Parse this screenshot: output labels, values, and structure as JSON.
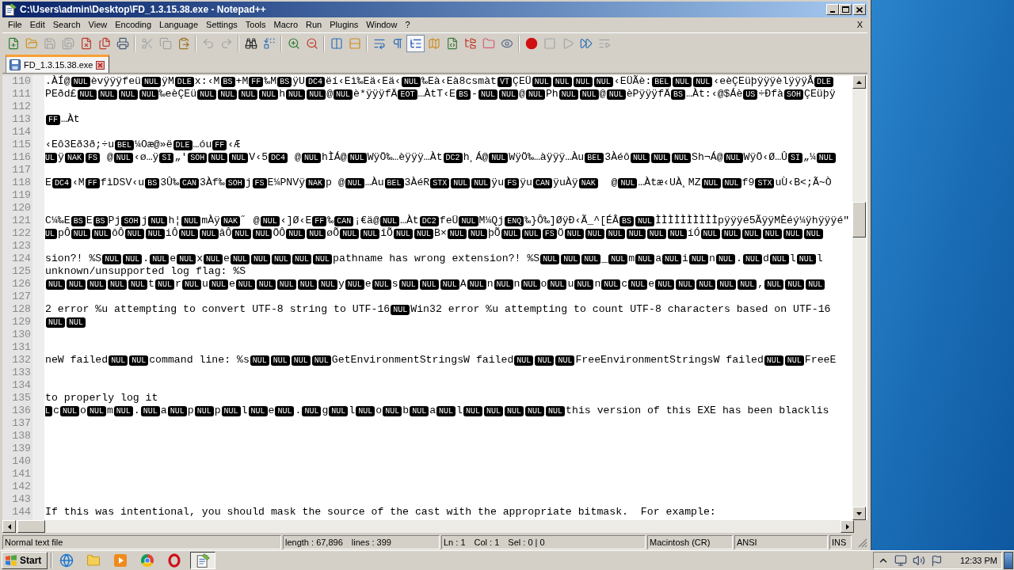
{
  "window": {
    "title": "C:\\Users\\admin\\Desktop\\FD_1.3.15.38.exe - Notepad++"
  },
  "menu": {
    "items": [
      "File",
      "Edit",
      "Search",
      "View",
      "Encoding",
      "Language",
      "Settings",
      "Tools",
      "Macro",
      "Run",
      "Plugins",
      "Window",
      "?"
    ],
    "close_document": "X"
  },
  "toolbar": [
    [
      {
        "kind": "new",
        "pressed": false,
        "disabled": false
      },
      {
        "kind": "open",
        "pressed": false,
        "disabled": false
      },
      {
        "kind": "save",
        "pressed": false,
        "disabled": true
      },
      {
        "kind": "save_all",
        "pressed": false,
        "disabled": true
      },
      {
        "kind": "close",
        "pressed": false,
        "disabled": false
      },
      {
        "kind": "close_all",
        "pressed": false,
        "disabled": false
      },
      {
        "kind": "print",
        "pressed": false,
        "disabled": false
      }
    ],
    [
      {
        "kind": "cut",
        "pressed": false,
        "disabled": true
      },
      {
        "kind": "copy",
        "pressed": false,
        "disabled": true
      },
      {
        "kind": "paste",
        "pressed": false,
        "disabled": false
      }
    ],
    [
      {
        "kind": "undo",
        "pressed": false,
        "disabled": true
      },
      {
        "kind": "redo",
        "pressed": false,
        "disabled": true
      }
    ],
    [
      {
        "kind": "find",
        "pressed": false,
        "disabled": false
      },
      {
        "kind": "replace",
        "pressed": false,
        "disabled": false
      }
    ],
    [
      {
        "kind": "zoom_in",
        "pressed": false,
        "disabled": false
      },
      {
        "kind": "zoom_out",
        "pressed": false,
        "disabled": false
      }
    ],
    [
      {
        "kind": "sync_vertical",
        "pressed": false,
        "disabled": false
      },
      {
        "kind": "sync_horizontal",
        "pressed": false,
        "disabled": false
      }
    ],
    [
      {
        "kind": "word_wrap",
        "pressed": false,
        "disabled": false
      },
      {
        "kind": "all_characters",
        "pressed": false,
        "disabled": false
      },
      {
        "kind": "indent_guide",
        "pressed": true,
        "disabled": false
      },
      {
        "kind": "document_map",
        "pressed": false,
        "disabled": false
      },
      {
        "kind": "function_list",
        "pressed": false,
        "disabled": false
      },
      {
        "kind": "folder_workspace",
        "pressed": false,
        "disabled": false
      },
      {
        "kind": "document_list",
        "pressed": false,
        "disabled": false
      },
      {
        "kind": "monitoring",
        "pressed": false,
        "disabled": false
      }
    ],
    [
      {
        "kind": "record",
        "pressed": false,
        "disabled": false
      },
      {
        "kind": "stop",
        "pressed": false,
        "disabled": true
      },
      {
        "kind": "playback",
        "pressed": false,
        "disabled": true
      },
      {
        "kind": "run_multiple",
        "pressed": false,
        "disabled": false
      },
      {
        "kind": "save_macro",
        "pressed": false,
        "disabled": true
      }
    ]
  ],
  "tabs": [
    {
      "label": "FD_1.3.15.38.exe",
      "selected": true
    }
  ],
  "editor": {
    "lines": [
      {
        "number": "110",
        "segments": [
          {
            "kind": "text",
            "text": ".ÀÍ@"
          },
          {
            "kind": "control",
            "text": "NUL"
          },
          {
            "kind": "text",
            "text": "èvÿÿÿfeü"
          },
          {
            "kind": "control",
            "text": "NUL"
          },
          {
            "kind": "text",
            "text": "ÿM"
          },
          {
            "kind": "control",
            "text": "DLE"
          },
          {
            "kind": "text",
            "text": "x:‹M"
          },
          {
            "kind": "control",
            "text": "BS"
          },
          {
            "kind": "text",
            "text": "+M"
          },
          {
            "kind": "control",
            "text": "FF"
          },
          {
            "kind": "text",
            "text": "‰M"
          },
          {
            "kind": "control",
            "text": "BS"
          },
          {
            "kind": "text",
            "text": "ÿU"
          },
          {
            "kind": "control",
            "text": "DC4"
          },
          {
            "kind": "text",
            "text": "ëí‹Eì‰Eä‹Eä‹"
          },
          {
            "kind": "control",
            "text": "NUL"
          },
          {
            "kind": "text",
            "text": "‰Eà‹Eà8csmàt"
          },
          {
            "kind": "control",
            "text": "VT"
          },
          {
            "kind": "text",
            "text": "ÇEÜ"
          },
          {
            "kind": "control",
            "text": "NUL"
          },
          {
            "kind": "control",
            "text": "NUL"
          },
          {
            "kind": "control",
            "text": "NUL"
          },
          {
            "kind": "control",
            "text": "NUL"
          },
          {
            "kind": "text",
            "text": "‹EÜÃè:"
          },
          {
            "kind": "control",
            "text": "BEL"
          },
          {
            "kind": "control",
            "text": "NUL"
          },
          {
            "kind": "control",
            "text": "NUL"
          },
          {
            "kind": "text",
            "text": "‹eèÇEüþÿÿÿèlÿÿÿÂ"
          },
          {
            "kind": "control",
            "text": "DLE"
          }
        ]
      },
      {
        "number": "111",
        "segments": [
          {
            "kind": "text",
            "text": "PEðd£"
          },
          {
            "kind": "control",
            "text": "NUL"
          },
          {
            "kind": "control",
            "text": "NUL"
          },
          {
            "kind": "control",
            "text": "NUL"
          },
          {
            "kind": "control",
            "text": "NUL"
          },
          {
            "kind": "text",
            "text": "‰eèÇEü"
          },
          {
            "kind": "control",
            "text": "NUL"
          },
          {
            "kind": "control",
            "text": "NUL"
          },
          {
            "kind": "control",
            "text": "NUL"
          },
          {
            "kind": "control",
            "text": "NUL"
          },
          {
            "kind": "text",
            "text": "h"
          },
          {
            "kind": "control",
            "text": "NUL"
          },
          {
            "kind": "control",
            "text": "NUL"
          },
          {
            "kind": "text",
            "text": "@"
          },
          {
            "kind": "control",
            "text": "NUL"
          },
          {
            "kind": "text",
            "text": "è*ÿÿÿfÄ"
          },
          {
            "kind": "control",
            "text": "EOT"
          },
          {
            "kind": "text",
            "text": "…ÀtT‹E"
          },
          {
            "kind": "control",
            "text": "BS"
          },
          {
            "kind": "text",
            "text": "-"
          },
          {
            "kind": "control",
            "text": "NUL"
          },
          {
            "kind": "control",
            "text": "NUL"
          },
          {
            "kind": "text",
            "text": "@"
          },
          {
            "kind": "control",
            "text": "NUL"
          },
          {
            "kind": "text",
            "text": "Ph"
          },
          {
            "kind": "control",
            "text": "NUL"
          },
          {
            "kind": "control",
            "text": "NUL"
          },
          {
            "kind": "text",
            "text": "@"
          },
          {
            "kind": "control",
            "text": "NUL"
          },
          {
            "kind": "text",
            "text": "èPÿÿÿfÄ"
          },
          {
            "kind": "control",
            "text": "BS"
          },
          {
            "kind": "text",
            "text": "…Àt:‹@$Áè"
          },
          {
            "kind": "control",
            "text": "US"
          },
          {
            "kind": "text",
            "text": "÷Ðfà"
          },
          {
            "kind": "control",
            "text": "SOH"
          },
          {
            "kind": "text",
            "text": "ÇEüþÿ"
          }
        ]
      },
      {
        "number": "112"
      },
      {
        "number": "113",
        "segments": [
          {
            "kind": "control",
            "text": "FF"
          },
          {
            "kind": "text",
            "text": "…Àt"
          }
        ]
      },
      {
        "number": "114"
      },
      {
        "number": "115",
        "segments": [
          {
            "kind": "text",
            "text": "‹Eô3Eð3ð;÷u"
          },
          {
            "kind": "control",
            "text": "BEL"
          },
          {
            "kind": "text",
            "text": "¼Oæ@»ë"
          },
          {
            "kind": "control",
            "text": "DLE"
          },
          {
            "kind": "text",
            "text": "…óu"
          },
          {
            "kind": "control",
            "text": "FF"
          },
          {
            "kind": "text",
            "text": "‹Æ"
          }
        ]
      },
      {
        "number": "116",
        "segments": [
          {
            "kind": "control_clipped",
            "text": "UL"
          },
          {
            "kind": "text",
            "text": "ÿ"
          },
          {
            "kind": "control",
            "text": "NAK"
          },
          {
            "kind": "control",
            "text": "FS"
          },
          {
            "kind": "text",
            "text": " @"
          },
          {
            "kind": "control",
            "text": "NUL"
          },
          {
            "kind": "text",
            "text": "‹ø…ÿ"
          },
          {
            "kind": "control",
            "text": "SI"
          },
          {
            "kind": "text",
            "text": "„'"
          },
          {
            "kind": "control",
            "text": "SOH"
          },
          {
            "kind": "control",
            "text": "NUL"
          },
          {
            "kind": "control",
            "text": "NUL"
          },
          {
            "kind": "text",
            "text": "V‹5"
          },
          {
            "kind": "control",
            "text": "DC4"
          },
          {
            "kind": "text",
            "text": " @"
          },
          {
            "kind": "control",
            "text": "NUL"
          },
          {
            "kind": "text",
            "text": "hÌÁ@"
          },
          {
            "kind": "control",
            "text": "NUL"
          },
          {
            "kind": "text",
            "text": "WÿÖ‰…èÿÿÿ…Àt"
          },
          {
            "kind": "control",
            "text": "DC2"
          },
          {
            "kind": "text",
            "text": "h¸Á@"
          },
          {
            "kind": "control",
            "text": "NUL"
          },
          {
            "kind": "text",
            "text": "WÿÖ‰…àÿÿÿ…Àu"
          },
          {
            "kind": "control",
            "text": "BEL"
          },
          {
            "kind": "text",
            "text": "3Àéô"
          },
          {
            "kind": "control",
            "text": "NUL"
          },
          {
            "kind": "control",
            "text": "NUL"
          },
          {
            "kind": "control",
            "text": "NUL"
          },
          {
            "kind": "text",
            "text": "Sh¬Á@"
          },
          {
            "kind": "control",
            "text": "NUL"
          },
          {
            "kind": "text",
            "text": "WÿÖ‹Ø…Û"
          },
          {
            "kind": "control",
            "text": "SI"
          },
          {
            "kind": "text",
            "text": "„¼"
          },
          {
            "kind": "control",
            "text": "NUL"
          }
        ]
      },
      {
        "number": "117"
      },
      {
        "number": "118",
        "segments": [
          {
            "kind": "text",
            "text": "E"
          },
          {
            "kind": "control",
            "text": "DC4"
          },
          {
            "kind": "text",
            "text": "‹M"
          },
          {
            "kind": "control",
            "text": "FF"
          },
          {
            "kind": "text",
            "text": "fìDSV‹u"
          },
          {
            "kind": "control",
            "text": "BS"
          },
          {
            "kind": "text",
            "text": "3Û‰"
          },
          {
            "kind": "control",
            "text": "CAN"
          },
          {
            "kind": "text",
            "text": "3Àf‰"
          },
          {
            "kind": "control",
            "text": "SOH"
          },
          {
            "kind": "text",
            "text": "j"
          },
          {
            "kind": "control",
            "text": "FS"
          },
          {
            "kind": "text",
            "text": "E¼PNVÿ"
          },
          {
            "kind": "control",
            "text": "NAK"
          },
          {
            "kind": "text",
            "text": "p @"
          },
          {
            "kind": "control",
            "text": "NUL"
          },
          {
            "kind": "text",
            "text": "…Àu"
          },
          {
            "kind": "control",
            "text": "BEL"
          },
          {
            "kind": "text",
            "text": "3ÀéR"
          },
          {
            "kind": "control",
            "text": "STX"
          },
          {
            "kind": "control",
            "text": "NUL"
          },
          {
            "kind": "control",
            "text": "NUL"
          },
          {
            "kind": "text",
            "text": "ÿu"
          },
          {
            "kind": "control",
            "text": "FS"
          },
          {
            "kind": "text",
            "text": "ÿu"
          },
          {
            "kind": "control",
            "text": "CAN"
          },
          {
            "kind": "text",
            "text": "ÿuÀÿ"
          },
          {
            "kind": "control",
            "text": "NAK"
          },
          {
            "kind": "text",
            "text": "  @"
          },
          {
            "kind": "control",
            "text": "NUL"
          },
          {
            "kind": "text",
            "text": "…Àtæ‹UÀ¸MZ"
          },
          {
            "kind": "control",
            "text": "NUL"
          },
          {
            "kind": "control",
            "text": "NUL"
          },
          {
            "kind": "text",
            "text": "f9"
          },
          {
            "kind": "control",
            "text": "STX"
          },
          {
            "kind": "text",
            "text": "uÙ‹B<;Ã~Ò"
          }
        ]
      },
      {
        "number": "119"
      },
      {
        "number": "120"
      },
      {
        "number": "121",
        "segments": [
          {
            "kind": "text",
            "text": "C¼‰E"
          },
          {
            "kind": "control",
            "text": "BS"
          },
          {
            "kind": "text",
            "text": "E"
          },
          {
            "kind": "control",
            "text": "BS"
          },
          {
            "kind": "text",
            "text": "Pj"
          },
          {
            "kind": "control",
            "text": "SOH"
          },
          {
            "kind": "text",
            "text": "j"
          },
          {
            "kind": "control",
            "text": "NUL"
          },
          {
            "kind": "text",
            "text": "h¦"
          },
          {
            "kind": "control",
            "text": "NUL"
          },
          {
            "kind": "text",
            "text": "mÀÿ"
          },
          {
            "kind": "control",
            "text": "NAK"
          },
          {
            "kind": "text",
            "text": "˝ @"
          },
          {
            "kind": "control",
            "text": "NUL"
          },
          {
            "kind": "text",
            "text": "‹]Ø‹E"
          },
          {
            "kind": "control",
            "text": "FF"
          },
          {
            "kind": "text",
            "text": "‰"
          },
          {
            "kind": "control",
            "text": "CAN"
          },
          {
            "kind": "text",
            "text": "¡€ä@"
          },
          {
            "kind": "control",
            "text": "NUL"
          },
          {
            "kind": "text",
            "text": "…Àt"
          },
          {
            "kind": "control",
            "text": "DC2"
          },
          {
            "kind": "text",
            "text": "feÜ"
          },
          {
            "kind": "control",
            "text": "NUL"
          },
          {
            "kind": "text",
            "text": "M¼Qj"
          },
          {
            "kind": "control",
            "text": "ENQ"
          },
          {
            "kind": "text",
            "text": "‰}Ô‰]ØÿÐ‹Ã_^[ÉÂ"
          },
          {
            "kind": "control",
            "text": "BS"
          },
          {
            "kind": "control",
            "text": "NUL"
          },
          {
            "kind": "text",
            "text": "ÌÌÌÌÌÌÌÌÌÌpÿÿÿé5ÃÿÿMÈéý¼ÿhÿÿÿé\""
          }
        ]
      },
      {
        "number": "122",
        "segments": [
          {
            "kind": "control_clipped",
            "text": "UL"
          },
          {
            "kind": "text",
            "text": "pÔ"
          },
          {
            "kind": "control",
            "text": "NUL"
          },
          {
            "kind": "control",
            "text": "NUL"
          },
          {
            "kind": "text",
            "text": "ôÔ"
          },
          {
            "kind": "control",
            "text": "NUL"
          },
          {
            "kind": "control",
            "text": "NUL"
          },
          {
            "kind": "text",
            "text": "iÔ"
          },
          {
            "kind": "control",
            "text": "NUL"
          },
          {
            "kind": "control",
            "text": "NUL"
          },
          {
            "kind": "text",
            "text": "âÔ"
          },
          {
            "kind": "control",
            "text": "NUL"
          },
          {
            "kind": "control",
            "text": "NUL"
          },
          {
            "kind": "text",
            "text": "ÖÔ"
          },
          {
            "kind": "control",
            "text": "NUL"
          },
          {
            "kind": "control",
            "text": "NUL"
          },
          {
            "kind": "text",
            "text": "øÕ"
          },
          {
            "kind": "control",
            "text": "NUL"
          },
          {
            "kind": "control",
            "text": "NUL"
          },
          {
            "kind": "text",
            "text": "îÕ"
          },
          {
            "kind": "control",
            "text": "NUL"
          },
          {
            "kind": "control",
            "text": "NUL"
          },
          {
            "kind": "text",
            "text": "B×"
          },
          {
            "kind": "control",
            "text": "NUL"
          },
          {
            "kind": "control",
            "text": "NUL"
          },
          {
            "kind": "text",
            "text": "þÕ"
          },
          {
            "kind": "control",
            "text": "NUL"
          },
          {
            "kind": "control",
            "text": "NUL"
          },
          {
            "kind": "control",
            "text": "FS"
          },
          {
            "kind": "text",
            "text": "Ö"
          },
          {
            "kind": "control",
            "text": "NUL"
          },
          {
            "kind": "control",
            "text": "NUL"
          },
          {
            "kind": "control",
            "text": "NUL"
          },
          {
            "kind": "control",
            "text": "NUL"
          },
          {
            "kind": "control",
            "text": "NUL"
          },
          {
            "kind": "control",
            "text": "NUL"
          },
          {
            "kind": "text",
            "text": "íÓ"
          },
          {
            "kind": "control",
            "text": "NUL"
          },
          {
            "kind": "control",
            "text": "NUL"
          },
          {
            "kind": "control",
            "text": "NUL"
          },
          {
            "kind": "control",
            "text": "NUL"
          },
          {
            "kind": "control",
            "text": "NUL"
          },
          {
            "kind": "control",
            "text": "NUL"
          }
        ]
      },
      {
        "number": "123"
      },
      {
        "number": "124",
        "segments": [
          {
            "kind": "text",
            "text": "sion?! %S"
          },
          {
            "kind": "control",
            "text": "NUL"
          },
          {
            "kind": "control",
            "text": "NUL"
          },
          {
            "kind": "text",
            "text": "."
          },
          {
            "kind": "control",
            "text": "NUL"
          },
          {
            "kind": "text",
            "text": "e"
          },
          {
            "kind": "control",
            "text": "NUL"
          },
          {
            "kind": "text",
            "text": "x"
          },
          {
            "kind": "control",
            "text": "NUL"
          },
          {
            "kind": "text",
            "text": "e"
          },
          {
            "kind": "control",
            "text": "NUL"
          },
          {
            "kind": "control",
            "text": "NUL"
          },
          {
            "kind": "control",
            "text": "NUL"
          },
          {
            "kind": "control",
            "text": "NUL"
          },
          {
            "kind": "control",
            "text": "NUL"
          },
          {
            "kind": "text",
            "text": "pathname has wrong extension?! %S"
          },
          {
            "kind": "control",
            "text": "NUL"
          },
          {
            "kind": "control",
            "text": "NUL"
          },
          {
            "kind": "control",
            "text": "NUL"
          },
          {
            "kind": "text",
            "text": "_"
          },
          {
            "kind": "control",
            "text": "NUL"
          },
          {
            "kind": "text",
            "text": "m"
          },
          {
            "kind": "control",
            "text": "NUL"
          },
          {
            "kind": "text",
            "text": "a"
          },
          {
            "kind": "control",
            "text": "NUL"
          },
          {
            "kind": "text",
            "text": "i"
          },
          {
            "kind": "control",
            "text": "NUL"
          },
          {
            "kind": "text",
            "text": "n"
          },
          {
            "kind": "control",
            "text": "NUL"
          },
          {
            "kind": "text",
            "text": "."
          },
          {
            "kind": "control",
            "text": "NUL"
          },
          {
            "kind": "text",
            "text": "d"
          },
          {
            "kind": "control",
            "text": "NUL"
          },
          {
            "kind": "text",
            "text": "l"
          },
          {
            "kind": "control",
            "text": "NUL"
          },
          {
            "kind": "text",
            "text": "l"
          }
        ]
      },
      {
        "number": "125",
        "segments": [
          {
            "kind": "text",
            "text": "unknown/unsupported log flag: %S"
          }
        ]
      },
      {
        "number": "126",
        "segments": [
          {
            "kind": "control",
            "text": "NUL"
          },
          {
            "kind": "control",
            "text": "NUL"
          },
          {
            "kind": "control",
            "text": "NUL"
          },
          {
            "kind": "control",
            "text": "NUL"
          },
          {
            "kind": "control",
            "text": "NUL"
          },
          {
            "kind": "text",
            "text": "t"
          },
          {
            "kind": "control",
            "text": "NUL"
          },
          {
            "kind": "text",
            "text": "r"
          },
          {
            "kind": "control",
            "text": "NUL"
          },
          {
            "kind": "text",
            "text": "u"
          },
          {
            "kind": "control",
            "text": "NUL"
          },
          {
            "kind": "text",
            "text": "e"
          },
          {
            "kind": "control",
            "text": "NUL"
          },
          {
            "kind": "control",
            "text": "NUL"
          },
          {
            "kind": "control",
            "text": "NUL"
          },
          {
            "kind": "control",
            "text": "NUL"
          },
          {
            "kind": "control",
            "text": "NUL"
          },
          {
            "kind": "text",
            "text": "y"
          },
          {
            "kind": "control",
            "text": "NUL"
          },
          {
            "kind": "text",
            "text": "e"
          },
          {
            "kind": "control",
            "text": "NUL"
          },
          {
            "kind": "text",
            "text": "s"
          },
          {
            "kind": "control",
            "text": "NUL"
          },
          {
            "kind": "control",
            "text": "NUL"
          },
          {
            "kind": "control",
            "text": "NUL"
          },
          {
            "kind": "text",
            "text": "A"
          },
          {
            "kind": "control",
            "text": "NUL"
          },
          {
            "kind": "text",
            "text": "n"
          },
          {
            "kind": "control",
            "text": "NUL"
          },
          {
            "kind": "text",
            "text": "n"
          },
          {
            "kind": "control",
            "text": "NUL"
          },
          {
            "kind": "text",
            "text": "o"
          },
          {
            "kind": "control",
            "text": "NUL"
          },
          {
            "kind": "text",
            "text": "u"
          },
          {
            "kind": "control",
            "text": "NUL"
          },
          {
            "kind": "text",
            "text": "n"
          },
          {
            "kind": "control",
            "text": "NUL"
          },
          {
            "kind": "text",
            "text": "c"
          },
          {
            "kind": "control",
            "text": "NUL"
          },
          {
            "kind": "text",
            "text": "e"
          },
          {
            "kind": "control",
            "text": "NUL"
          },
          {
            "kind": "control",
            "text": "NUL"
          },
          {
            "kind": "control",
            "text": "NUL"
          },
          {
            "kind": "control",
            "text": "NUL"
          },
          {
            "kind": "control",
            "text": "NUL"
          },
          {
            "kind": "text",
            "text": ","
          },
          {
            "kind": "control",
            "text": "NUL"
          },
          {
            "kind": "control",
            "text": "NUL"
          },
          {
            "kind": "control",
            "text": "NUL"
          }
        ]
      },
      {
        "number": "127"
      },
      {
        "number": "128",
        "segments": [
          {
            "kind": "text",
            "text": "2 error %u attempting to convert UTF-8 string to UTF-16"
          },
          {
            "kind": "control",
            "text": "NUL"
          },
          {
            "kind": "text",
            "text": "Win32 error %u attempting to count UTF-8 characters based on UTF-16"
          }
        ]
      },
      {
        "number": "129",
        "segments": [
          {
            "kind": "control",
            "text": "NUL"
          },
          {
            "kind": "control",
            "text": "NUL"
          }
        ]
      },
      {
        "number": "130"
      },
      {
        "number": "131"
      },
      {
        "number": "132",
        "segments": [
          {
            "kind": "text",
            "text": "neW failed"
          },
          {
            "kind": "control",
            "text": "NUL"
          },
          {
            "kind": "control",
            "text": "NUL"
          },
          {
            "kind": "text",
            "text": "command line: %s"
          },
          {
            "kind": "control",
            "text": "NUL"
          },
          {
            "kind": "control",
            "text": "NUL"
          },
          {
            "kind": "control",
            "text": "NUL"
          },
          {
            "kind": "control",
            "text": "NUL"
          },
          {
            "kind": "text",
            "text": "GetEnvironmentStringsW failed"
          },
          {
            "kind": "control",
            "text": "NUL"
          },
          {
            "kind": "control",
            "text": "NUL"
          },
          {
            "kind": "control",
            "text": "NUL"
          },
          {
            "kind": "text",
            "text": "FreeEnvironmentStringsW failed"
          },
          {
            "kind": "control",
            "text": "NUL"
          },
          {
            "kind": "control",
            "text": "NUL"
          },
          {
            "kind": "text",
            "text": "FreeE"
          }
        ]
      },
      {
        "number": "133"
      },
      {
        "number": "134"
      },
      {
        "number": "135",
        "segments": [
          {
            "kind": "text",
            "text": "to properly log it"
          }
        ]
      },
      {
        "number": "136",
        "segments": [
          {
            "kind": "control_clipped",
            "text": "L"
          },
          {
            "kind": "text",
            "text": "c"
          },
          {
            "kind": "control",
            "text": "NUL"
          },
          {
            "kind": "text",
            "text": "o"
          },
          {
            "kind": "control",
            "text": "NUL"
          },
          {
            "kind": "text",
            "text": "m"
          },
          {
            "kind": "control",
            "text": "NUL"
          },
          {
            "kind": "text",
            "text": "."
          },
          {
            "kind": "control",
            "text": "NUL"
          },
          {
            "kind": "text",
            "text": "a"
          },
          {
            "kind": "control",
            "text": "NUL"
          },
          {
            "kind": "text",
            "text": "p"
          },
          {
            "kind": "control",
            "text": "NUL"
          },
          {
            "kind": "text",
            "text": "p"
          },
          {
            "kind": "control",
            "text": "NUL"
          },
          {
            "kind": "text",
            "text": "l"
          },
          {
            "kind": "control",
            "text": "NUL"
          },
          {
            "kind": "text",
            "text": "e"
          },
          {
            "kind": "control",
            "text": "NUL"
          },
          {
            "kind": "text",
            "text": "."
          },
          {
            "kind": "control",
            "text": "NUL"
          },
          {
            "kind": "text",
            "text": "g"
          },
          {
            "kind": "control",
            "text": "NUL"
          },
          {
            "kind": "text",
            "text": "l"
          },
          {
            "kind": "control",
            "text": "NUL"
          },
          {
            "kind": "text",
            "text": "o"
          },
          {
            "kind": "control",
            "text": "NUL"
          },
          {
            "kind": "text",
            "text": "b"
          },
          {
            "kind": "control",
            "text": "NUL"
          },
          {
            "kind": "text",
            "text": "a"
          },
          {
            "kind": "control",
            "text": "NUL"
          },
          {
            "kind": "text",
            "text": "l"
          },
          {
            "kind": "control",
            "text": "NUL"
          },
          {
            "kind": "control",
            "text": "NUL"
          },
          {
            "kind": "control",
            "text": "NUL"
          },
          {
            "kind": "control",
            "text": "NUL"
          },
          {
            "kind": "control",
            "text": "NUL"
          },
          {
            "kind": "text",
            "text": "this version of this EXE has been blacklis"
          }
        ]
      },
      {
        "number": "137"
      },
      {
        "number": "138"
      },
      {
        "number": "139"
      },
      {
        "number": "140"
      },
      {
        "number": "141"
      },
      {
        "number": "142"
      },
      {
        "number": "143"
      },
      {
        "number": "144",
        "segments": [
          {
            "kind": "text",
            "text": "If this was intentional, you should mask the source of the cast with the appropriate bitmask.  For example:"
          }
        ]
      }
    ]
  },
  "status_bar": [
    [
      "Normal text file"
    ],
    [
      "length : 67,896",
      "lines : 399"
    ],
    [
      "Ln : 1",
      "Col : 1",
      "Sel : 0 | 0"
    ],
    [
      "Macintosh (CR)"
    ],
    [
      "ANSI"
    ],
    [
      "INS"
    ]
  ],
  "taskbar": {
    "start": "Start",
    "apps": [
      {
        "kind": "globe",
        "selected": false
      },
      {
        "kind": "folder",
        "selected": false
      },
      {
        "kind": "media",
        "selected": false
      },
      {
        "kind": "wheel",
        "selected": false
      },
      {
        "kind": "ring",
        "selected": false
      },
      {
        "kind": "notepad",
        "selected": true
      }
    ],
    "clock": "12:33 PM"
  }
}
